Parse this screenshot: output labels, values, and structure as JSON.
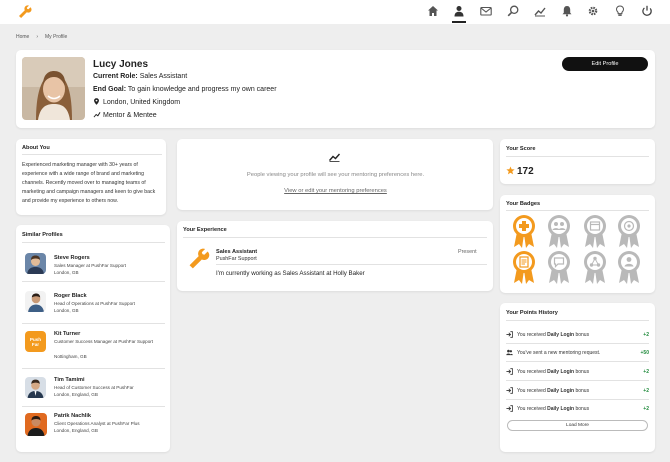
{
  "nav": {
    "icons": [
      "home-icon",
      "user-icon",
      "mail-icon",
      "search-icon",
      "chart-icon",
      "bell-icon",
      "gear-icon",
      "lightbulb-icon",
      "power-icon"
    ]
  },
  "breadcrumb": {
    "home": "Home",
    "sep": "›",
    "current": "My Profile"
  },
  "profile": {
    "name": "Lucy Jones",
    "role_label": "Current Role:",
    "role": "Sales Assistant",
    "goal_label": "End Goal:",
    "goal": "To gain knowledge and progress my own career",
    "location": "London, United Kingdom",
    "mentor_type": "Mentor & Mentee",
    "edit_label": "Edit Profile"
  },
  "about": {
    "title": "About You",
    "text": "Experienced marketing manager with 30+ years of experience with a wide range of brand and marketing channels. Recently moved over to managing teams of marketing and campaign managers and keen to give back and provide my experience to others now."
  },
  "similar": {
    "title": "Similar Profiles",
    "items": [
      {
        "name": "Steve Rogers",
        "role": "Sales Manager at PushFar Support",
        "location": "London, GB"
      },
      {
        "name": "Roger Black",
        "role": "Head of Operations at PushFar Support",
        "location": "London, GB"
      },
      {
        "name": "Kit Turner",
        "role": "Customer Success Manager at PushFar Support",
        "location": "Nottingham, GB",
        "logo_text": "Push Far"
      },
      {
        "name": "Tim Tamimi",
        "role": "Head of Customer Success at PushFar",
        "location": "London, England, GB"
      },
      {
        "name": "Patrik Nachlik",
        "role": "Client Operations Analyst at PushFar Plus",
        "location": "London, England, GB"
      }
    ]
  },
  "mentoring": {
    "text": "People viewing your profile will see your mentoring preferences here.",
    "link": "View or edit your mentoring preferences"
  },
  "experience": {
    "title": "Your Experience",
    "job_title": "Sales Assistant",
    "company": "PushFar Support",
    "period": "Present",
    "description": "I'm currently working as Sales Assistant at Holly Baker"
  },
  "score": {
    "title": "Your Score",
    "value": "172"
  },
  "badges": {
    "title": "Your Badges"
  },
  "points": {
    "title": "Your Points History",
    "rows": [
      {
        "prefix": "You received ",
        "bold": "Daily Login",
        "suffix": " bonus",
        "value": "+2"
      },
      {
        "prefix": "You've sent a new mentoring request.",
        "bold": "",
        "suffix": "",
        "value": "+50"
      },
      {
        "prefix": "You received ",
        "bold": "Daily Login",
        "suffix": " bonus",
        "value": "+2"
      },
      {
        "prefix": "You received ",
        "bold": "Daily Login",
        "suffix": " bonus",
        "value": "+2"
      },
      {
        "prefix": "You received ",
        "bold": "Daily Login",
        "suffix": " bonus",
        "value": "+2"
      }
    ],
    "load_more": "Load More"
  },
  "colors": {
    "accent": "#f39a1e",
    "dark": "#111111",
    "positive": "#1f8a3b",
    "badge_grey": "#b9b9b9"
  }
}
